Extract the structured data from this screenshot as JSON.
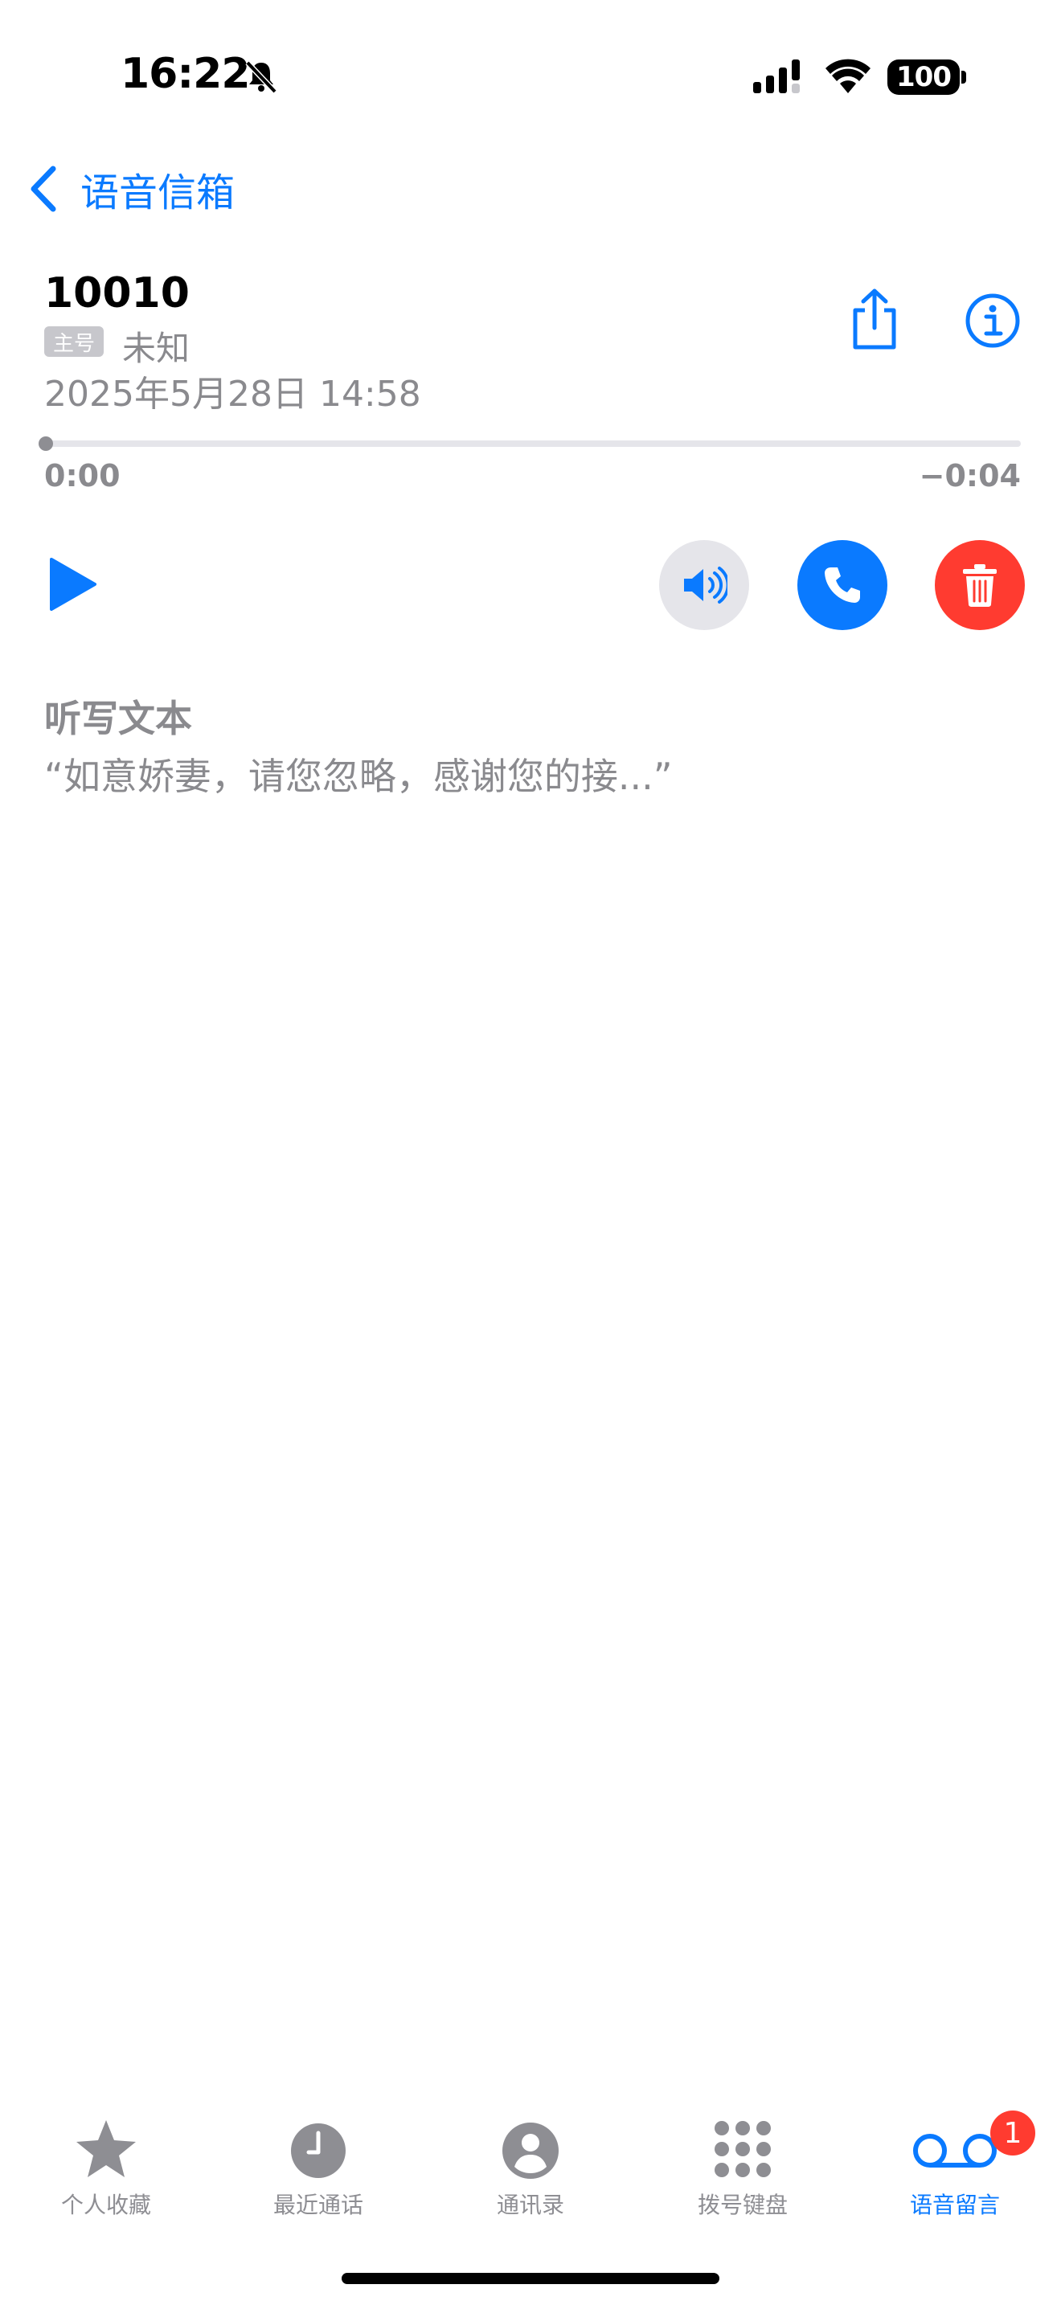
{
  "status_bar": {
    "time": "16:22",
    "battery": "100"
  },
  "nav": {
    "back_label": "语音信箱"
  },
  "voicemail": {
    "number": "10010",
    "line_badge": "主号",
    "caller_label": "未知",
    "datetime": "2025年5月28日 14:58",
    "elapsed": "0:00",
    "remaining": "−0:04",
    "progress": 0.0
  },
  "transcription": {
    "title": "听写文本",
    "text": "“如意娇妻，请您忽略，感谢您的接...”"
  },
  "tab_bar": {
    "tabs": [
      {
        "label": "个人收藏",
        "icon": "star-icon"
      },
      {
        "label": "最近通话",
        "icon": "clock-icon"
      },
      {
        "label": "通讯录",
        "icon": "person-circle-icon"
      },
      {
        "label": "拨号键盘",
        "icon": "keypad-icon"
      },
      {
        "label": "语音留言",
        "icon": "voicemail-icon"
      }
    ],
    "active_index": 4,
    "voicemail_badge": "1"
  },
  "colors": {
    "accent": "#0a7aff",
    "destructive": "#ff3b30",
    "secondary_text": "#8a8a8e"
  }
}
